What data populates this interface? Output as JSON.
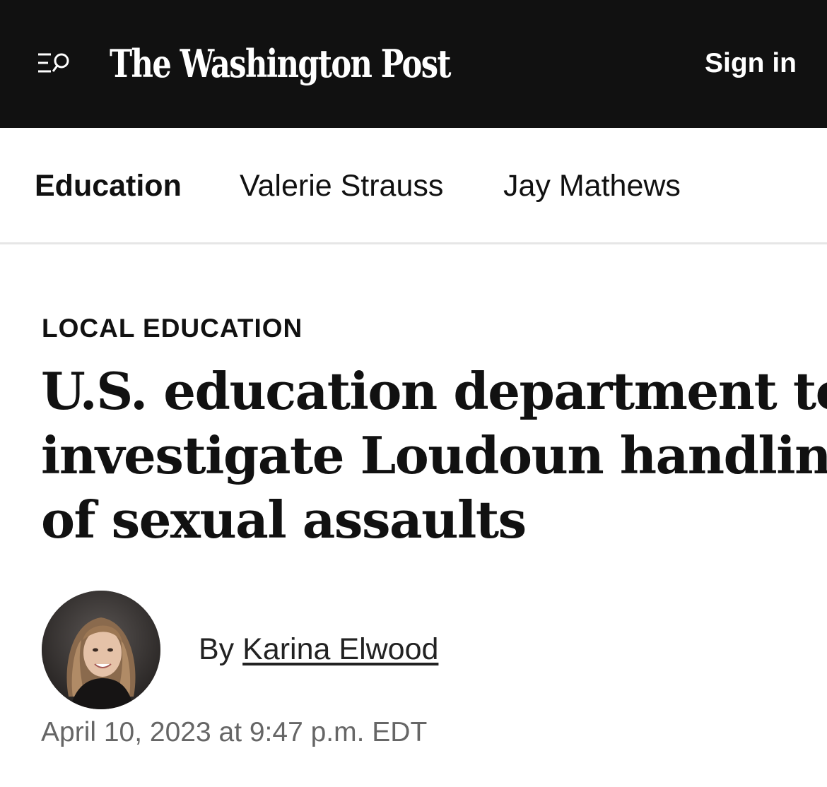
{
  "header": {
    "menu_icon": "menu-search-icon",
    "masthead": "The Washington Post",
    "signin_label": "Sign in",
    "background_color": "#111111"
  },
  "subnav": {
    "items": [
      {
        "label": "Education",
        "active": true
      },
      {
        "label": "Valerie Strauss",
        "active": false
      },
      {
        "label": "Jay Mathews",
        "active": false
      }
    ]
  },
  "article": {
    "kicker": "LOCAL EDUCATION",
    "headline_lines": [
      "U.S. education department to",
      "investigate Loudoun handling",
      "of sexual assaults"
    ],
    "byline_prefix": "By",
    "author": "Karina Elwood",
    "author_avatar_icon": "author-photo",
    "timestamp": "April 10, 2023 at 9:47 p.m. EDT"
  }
}
